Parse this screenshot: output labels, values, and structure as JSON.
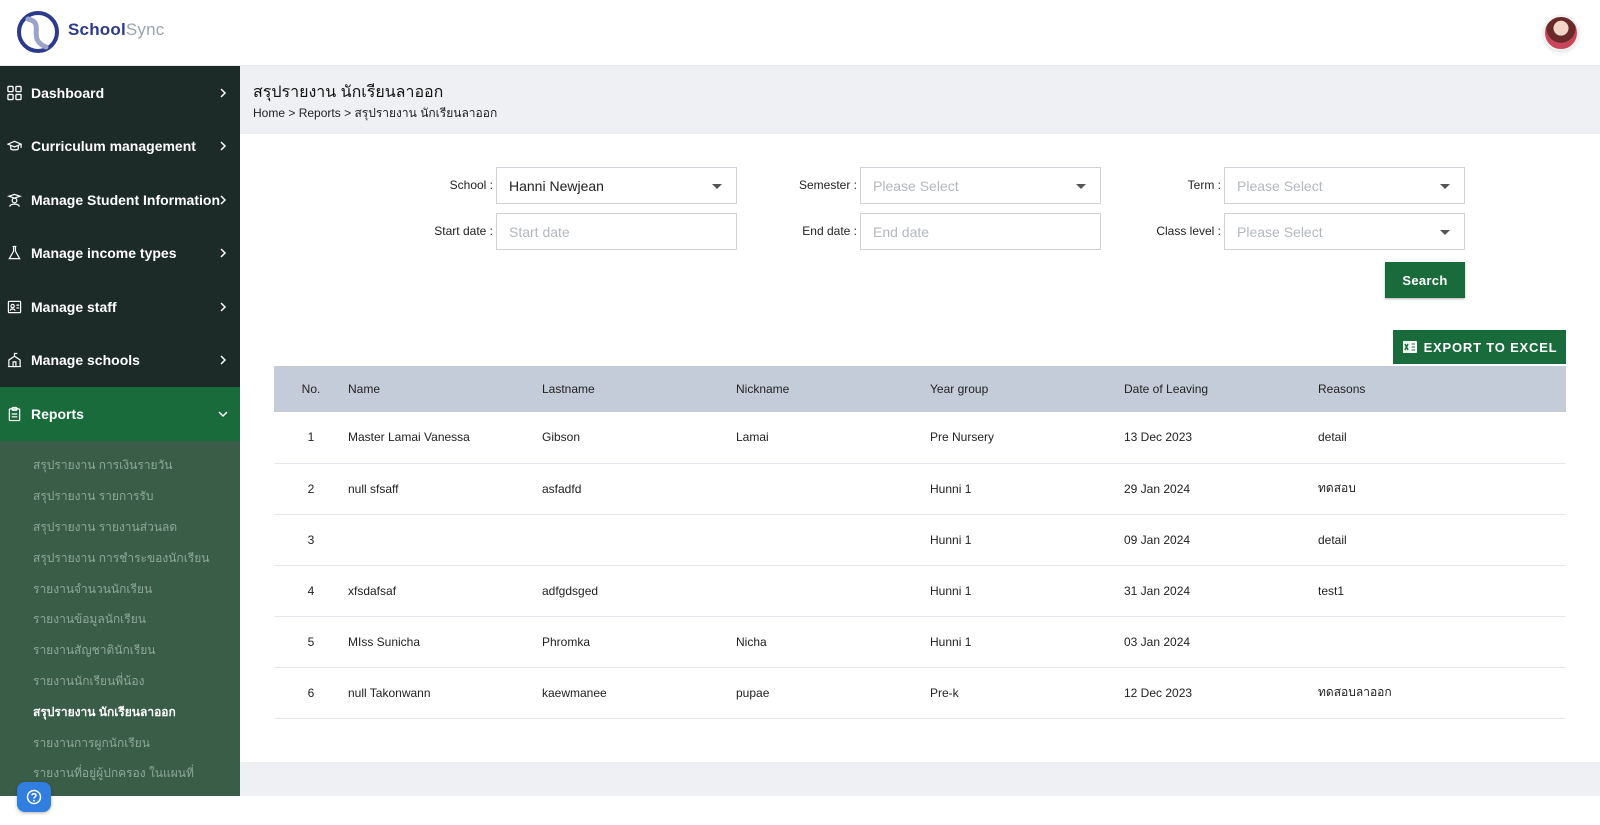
{
  "brand": {
    "name_part1": "School",
    "name_part2": "Sync"
  },
  "sidebar": {
    "items": [
      {
        "label": "Dashboard",
        "icon": "grid-icon"
      },
      {
        "label": "Curriculum management",
        "icon": "graduation-cap-icon"
      },
      {
        "label": "Manage Student Information",
        "icon": "student-icon"
      },
      {
        "label": "Manage income types",
        "icon": "flask-icon"
      },
      {
        "label": "Manage staff",
        "icon": "id-card-icon"
      },
      {
        "label": "Manage schools",
        "icon": "school-icon"
      },
      {
        "label": "Reports",
        "icon": "clipboard-icon"
      }
    ],
    "report_subitems": [
      "สรุปรายงาน การเงินรายวัน",
      "สรุปรายงาน รายการรับ",
      "สรุปรายงาน รายงานส่วนลด",
      "สรุปรายงาน การชำระของนักเรียน",
      "รายงานจำนวนนักเรียน",
      "รายงานข้อมูลนักเรียน",
      "รายงานสัญชาตินักเรียน",
      "รายงานนักเรียนพี่น้อง",
      "สรุปรายงาน นักเรียนลาออก",
      "รายงานการผูกนักเรียน",
      "รายงานที่อยู่ผู้ปกครอง ในแผนที่"
    ]
  },
  "page": {
    "title": "สรุปรายงาน นักเรียนลาออก",
    "breadcrumb": {
      "home": "Home",
      "sep": ">",
      "reports": "Reports",
      "current": "สรุปรายงาน นักเรียนลาออก"
    }
  },
  "filters": {
    "school_label": "School :",
    "school_value": "Hanni Newjean",
    "semester_label": "Semester :",
    "semester_placeholder": "Please Select",
    "term_label": "Term :",
    "term_placeholder": "Please Select",
    "start_label": "Start date :",
    "start_placeholder": "Start date",
    "end_label": "End date :",
    "end_placeholder": "End date",
    "class_label": "Class level :",
    "class_placeholder": "Please Select",
    "search_label": "Search"
  },
  "export_label": "EXPORT TO EXCEL",
  "table": {
    "headers": [
      "No.",
      "Name",
      "Lastname",
      "Nickname",
      "Year group",
      "Date of Leaving",
      "Reasons"
    ],
    "rows": [
      [
        "1",
        "Master Lamai Vanessa",
        "Gibson",
        "Lamai",
        "Pre Nursery",
        "13 Dec 2023",
        "detail"
      ],
      [
        "2",
        "null sfsaff",
        "asfadfd",
        "",
        "Hunni 1",
        "29 Jan 2024",
        "ทดสอบ"
      ],
      [
        "3",
        "",
        "",
        "",
        "Hunni 1",
        "09 Jan 2024",
        "detail"
      ],
      [
        "4",
        "xfsdafsaf",
        "adfgdsged",
        "",
        "Hunni 1",
        "31 Jan 2024",
        "test1"
      ],
      [
        "5",
        "MIss Sunicha",
        "Phromka",
        "Nicha",
        "Hunni 1",
        "03 Jan 2024",
        ""
      ],
      [
        "6",
        "null Takonwann",
        "kaewmanee",
        "pupae",
        "Pre-k",
        "12 Dec 2023",
        "ทดสอบลาออก"
      ]
    ]
  },
  "colors": {
    "accent": "#1a6b3c",
    "sidebar": "#1c2b28",
    "submenu": "#3a5d48",
    "table_header": "#c5ccd9"
  }
}
